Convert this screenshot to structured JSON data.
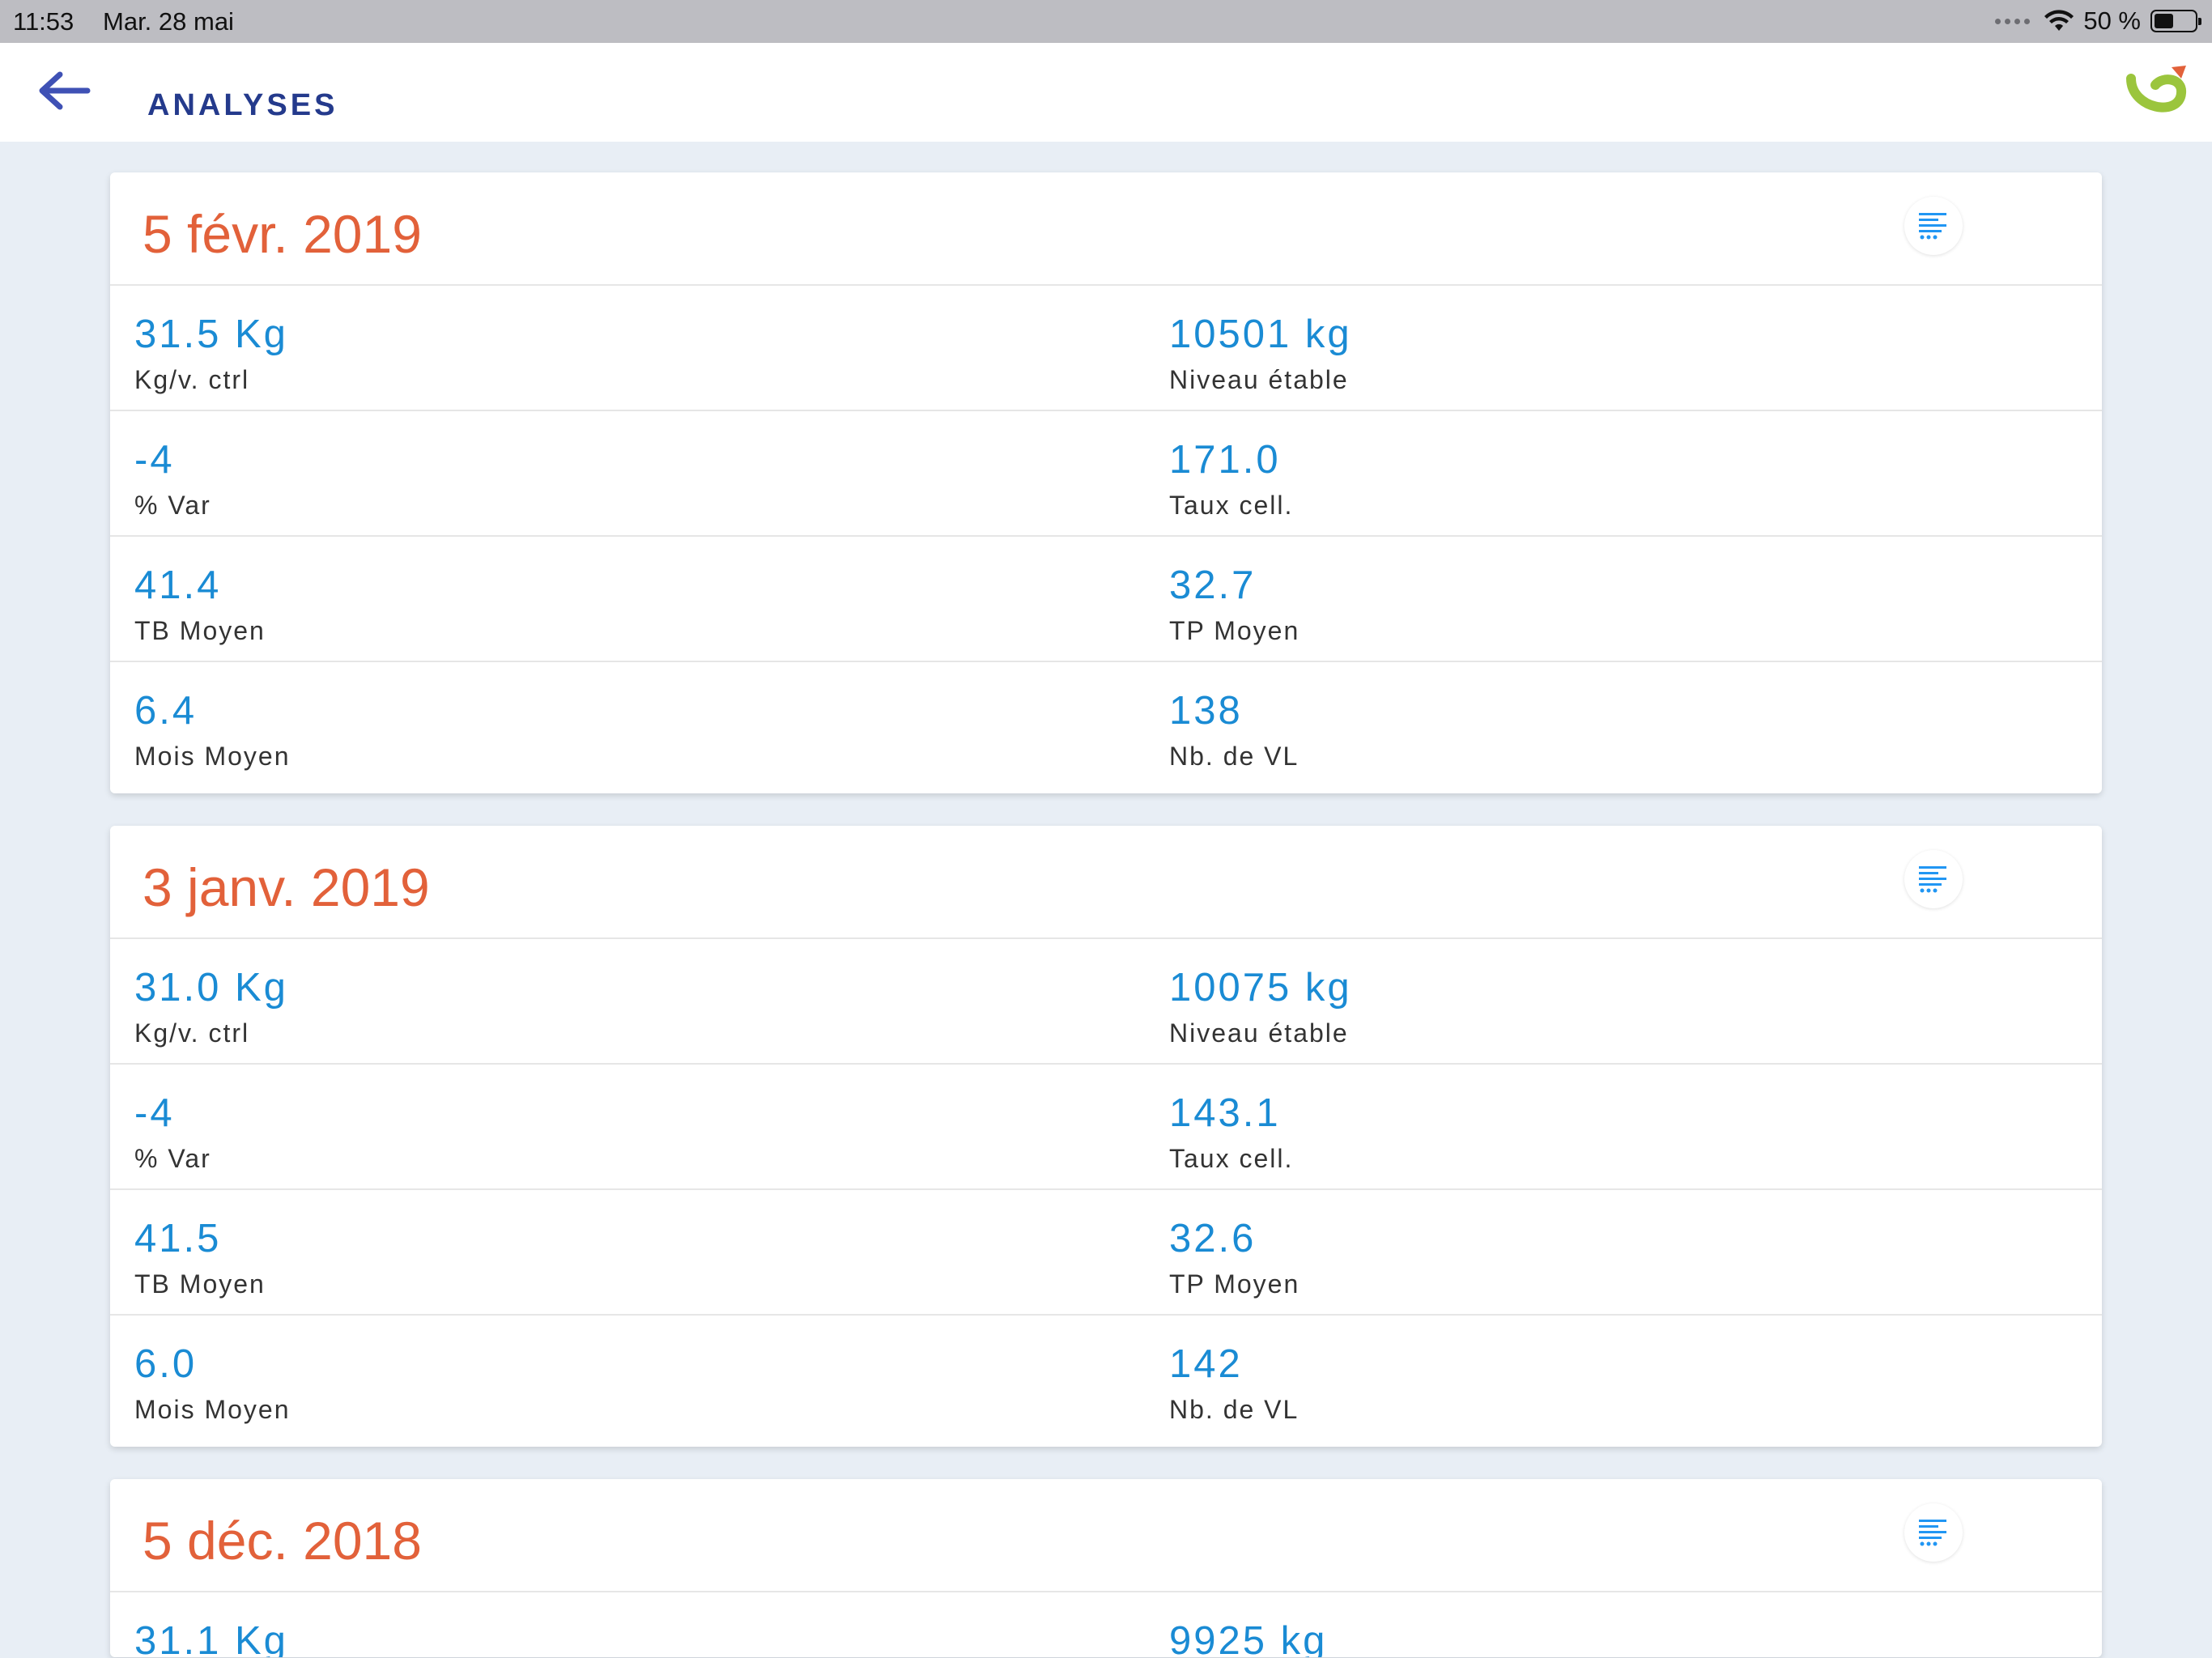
{
  "status_bar": {
    "time": "11:53",
    "date": "Mar. 28 mai",
    "battery_text": "50 %"
  },
  "header": {
    "title": "ANALYSES"
  },
  "colors": {
    "accent_orange": "#e2613a",
    "value_blue": "#1a8bd4",
    "title_navy": "#243a8c",
    "logo_green": "#9bc53d"
  },
  "analyses": [
    {
      "date": "5 févr. 2019",
      "rows": [
        [
          {
            "value": "31.5 Kg",
            "label": "Kg/v. ctrl"
          },
          {
            "value": "10501 kg",
            "label": "Niveau étable"
          }
        ],
        [
          {
            "value": "-4",
            "label": "% Var"
          },
          {
            "value": "171.0",
            "label": "Taux cell."
          }
        ],
        [
          {
            "value": "41.4",
            "label": "TB Moyen"
          },
          {
            "value": "32.7",
            "label": "TP Moyen"
          }
        ],
        [
          {
            "value": "6.4",
            "label": "Mois Moyen"
          },
          {
            "value": "138",
            "label": "Nb. de VL"
          }
        ]
      ]
    },
    {
      "date": "3 janv. 2019",
      "rows": [
        [
          {
            "value": "31.0 Kg",
            "label": "Kg/v. ctrl"
          },
          {
            "value": "10075 kg",
            "label": "Niveau étable"
          }
        ],
        [
          {
            "value": "-4",
            "label": "% Var"
          },
          {
            "value": "143.1",
            "label": "Taux cell."
          }
        ],
        [
          {
            "value": "41.5",
            "label": "TB Moyen"
          },
          {
            "value": "32.6",
            "label": "TP Moyen"
          }
        ],
        [
          {
            "value": "6.0",
            "label": "Mois Moyen"
          },
          {
            "value": "142",
            "label": "Nb. de VL"
          }
        ]
      ]
    },
    {
      "date": "5 déc. 2018",
      "rows": [
        [
          {
            "value": "31.1 Kg",
            "label": ""
          },
          {
            "value": "9925 kg",
            "label": ""
          }
        ]
      ]
    }
  ]
}
